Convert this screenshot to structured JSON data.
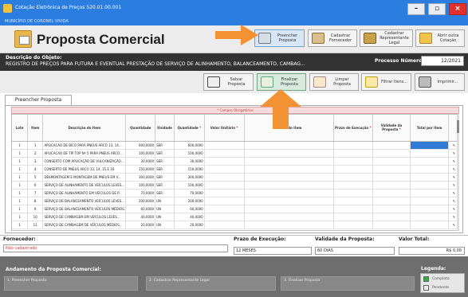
{
  "window": {
    "title": "Cotação Eletrônica de Preços 520.01.00.001",
    "subtitle": "MUNICÍPIO DE CORONEL VIVIDA",
    "minimize": "–",
    "maximize": "▫",
    "close": "×"
  },
  "header": {
    "title": "Proposta Comercial",
    "buttons": [
      {
        "label": "Preencher\nProposta",
        "icon": "document-icon"
      },
      {
        "label": "Cadastrar\nFornecedor",
        "icon": "users-icon"
      },
      {
        "label": "Cadastrar\nRepresentante\nLegal",
        "icon": "representative-icon"
      },
      {
        "label": "Abrir outra\nCotação",
        "icon": "folder-icon"
      }
    ]
  },
  "object": {
    "label": "Descrição do Objeto:",
    "value": "REGISTRO DE PREÇOS PARA FUTURA E EVENTUAL PRESTAÇÃO DE SERVIÇO DE ALINHAMENTO, BALANCEAMENTO, CAMBAG...",
    "processo_label": "Processo Número:",
    "processo_value": "12/2021"
  },
  "actions": [
    {
      "label": "Salvar\nProposta",
      "icon": "save-icon"
    },
    {
      "label": "Finalizar\nProposta",
      "icon": "finalize-icon"
    },
    {
      "label": "Limpar\nProposta",
      "icon": "clean-icon"
    },
    {
      "label": "Filtrar Itens...",
      "icon": "filter-icon"
    },
    {
      "label": "Imprimir...",
      "icon": "print-icon"
    }
  ],
  "tab": "Preencher Proposta",
  "grid": {
    "banner": "* Campos Obrigatórios",
    "columns": [
      "Lote",
      "Item",
      "Descrição do Item",
      "Quantidade",
      "Unidade",
      "Quantidade *",
      "Valor Unitário *",
      "Marca do Item",
      "Prazo de Execução *",
      "Validade da Proposta *",
      "Total por Item",
      ""
    ],
    "rows": [
      [
        "1",
        "1",
        "APLICACAO DE BICO PARA PNEUS ARCO 13, 14...",
        "600,0000",
        "SER",
        "600,0000"
      ],
      [
        "1",
        "2",
        "APLICACAO DE TIP TOP Nº 5 PARA PNEUS ARCO...",
        "100,0000",
        "SER",
        "100,0000"
      ],
      [
        "1",
        "3",
        "CONSERTO COM APLICAÇÃO DE VULCANIZAÇÃO...",
        "30,0000",
        "SER",
        "30,0000"
      ],
      [
        "1",
        "4",
        "CONSERTO DE PNEUS ARCO 13, 14, 15 E 16",
        "150,0000",
        "SER",
        "150,0000"
      ],
      [
        "1",
        "5",
        "DESMONTAGEM E MONTAGEM DE PNEUS EM V...",
        "300,0000",
        "SER",
        "300,0000"
      ],
      [
        "1",
        "6",
        "SERVIÇO DE ALINHAMENTO DE VEÍCULOS LEVES...",
        "100,0000",
        "SER",
        "100,0000"
      ],
      [
        "1",
        "7",
        "SERVIÇO DE ALINHAMENTO EM VEÍCULOS DE P...",
        "70,0000",
        "SER",
        "70,0000"
      ],
      [
        "1",
        "8",
        "SERVIÇO DE BALANCEAMENTO VEÍCULOS LEVES...",
        "200,0000",
        "UN",
        "200,0000"
      ],
      [
        "1",
        "9",
        "SERVIÇO DE BALANCEAMENTO VEÍCULOS MÉDIOS...",
        "60,0000",
        "UN",
        "60,0000"
      ],
      [
        "1",
        "10",
        "SERVIÇO DE CAMBAGEM EM VEÍCULOS LEVES...",
        "40,0000",
        "UN",
        "40,0000"
      ],
      [
        "1",
        "11",
        "SERVIÇO DE CAMBAGEM DE VEÍCULOS MÉDIOS...",
        "20,0000",
        "UN",
        "20,0000"
      ]
    ]
  },
  "footer": {
    "fornecedor_label": "Fornecedor:",
    "fornecedor_value": "Não cadastrado",
    "prazo_label": "Prazo de Execução:",
    "prazo_value": "12 MESES",
    "validade_label": "Validade da Proposta:",
    "validade_value": "60 DIAS",
    "total_label": "Valor Total:",
    "total_value": "R$ 0,00"
  },
  "progress": {
    "label": "Andamento da Proposta Comercial:",
    "steps": [
      "1. Preencher Proposta",
      "2. Cadastrar Representante Legal",
      "3. Finalizar Proposta"
    ],
    "legend_label": "Legenda:",
    "legend": [
      {
        "label": "Completo",
        "color": "#3aa84d"
      },
      {
        "label": "Pendente",
        "color": "#eeeeee"
      }
    ]
  },
  "colors": {
    "titlebar": "#2b7de0",
    "highlight_arrow": "#f39232",
    "required": "#cc3333"
  }
}
